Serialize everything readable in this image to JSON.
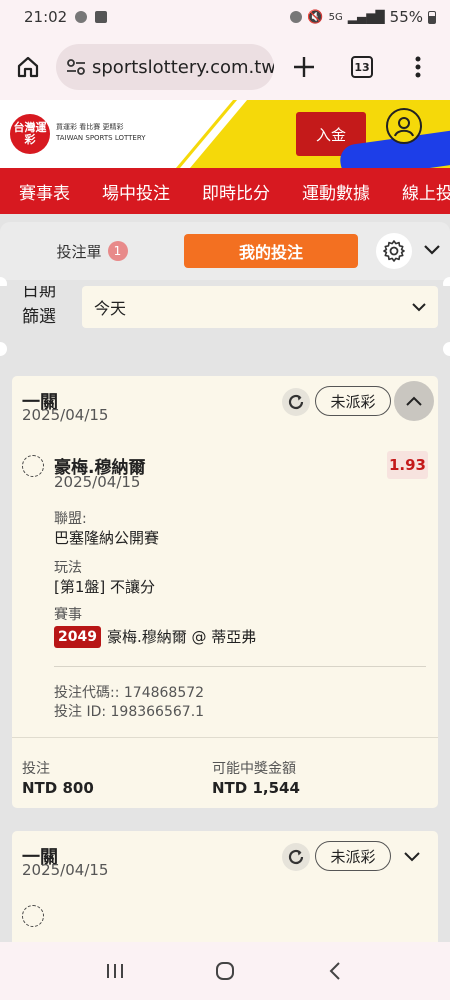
{
  "status_bar": {
    "time": "21:02",
    "network": "5G",
    "battery": "55%"
  },
  "browser": {
    "url": "sportslottery.com.tw",
    "tab_count": "13"
  },
  "site": {
    "logo_text": "台灣運彩",
    "logo_sub": "買運彩 看比賽 更精彩",
    "logo_sub_en": "TAIWAN SPORTS LOTTERY",
    "deposit_label": "入金",
    "brand_red": "#d71920",
    "brand_yellow": "#f5d90a",
    "accent_orange": "#f37021"
  },
  "nav": {
    "items": [
      "賽事表",
      "場中投注",
      "即時比分",
      "運動數據",
      "線上投"
    ]
  },
  "panel": {
    "betslip_label": "投注單",
    "betslip_count": "1",
    "mybets_label": "我的投注"
  },
  "filter": {
    "label": "日期篩選",
    "value": "今天"
  },
  "bets": [
    {
      "type": "一關",
      "date": "2025/04/15",
      "status": "未派彩",
      "selection": "豪梅.穆納爾",
      "selection_date": "2025/04/15",
      "odds": "1.93",
      "league_label": "聯盟:",
      "league": "巴塞隆納公開賽",
      "market_label": "玩法",
      "market": "[第1盤] 不讓分",
      "event_label": "賽事",
      "event_no": "2049",
      "event": "豪梅.穆納爾 @ 蒂亞弗",
      "code_line": "投注代碼:: 174868572",
      "id_line": "投注 ID: 198366567.1",
      "stake_label": "投注",
      "stake": "NTD 800",
      "payout_label": "可能中獎金額",
      "payout": "NTD 1,544"
    },
    {
      "type": "一關",
      "date": "2025/04/15",
      "status": "未派彩"
    }
  ]
}
